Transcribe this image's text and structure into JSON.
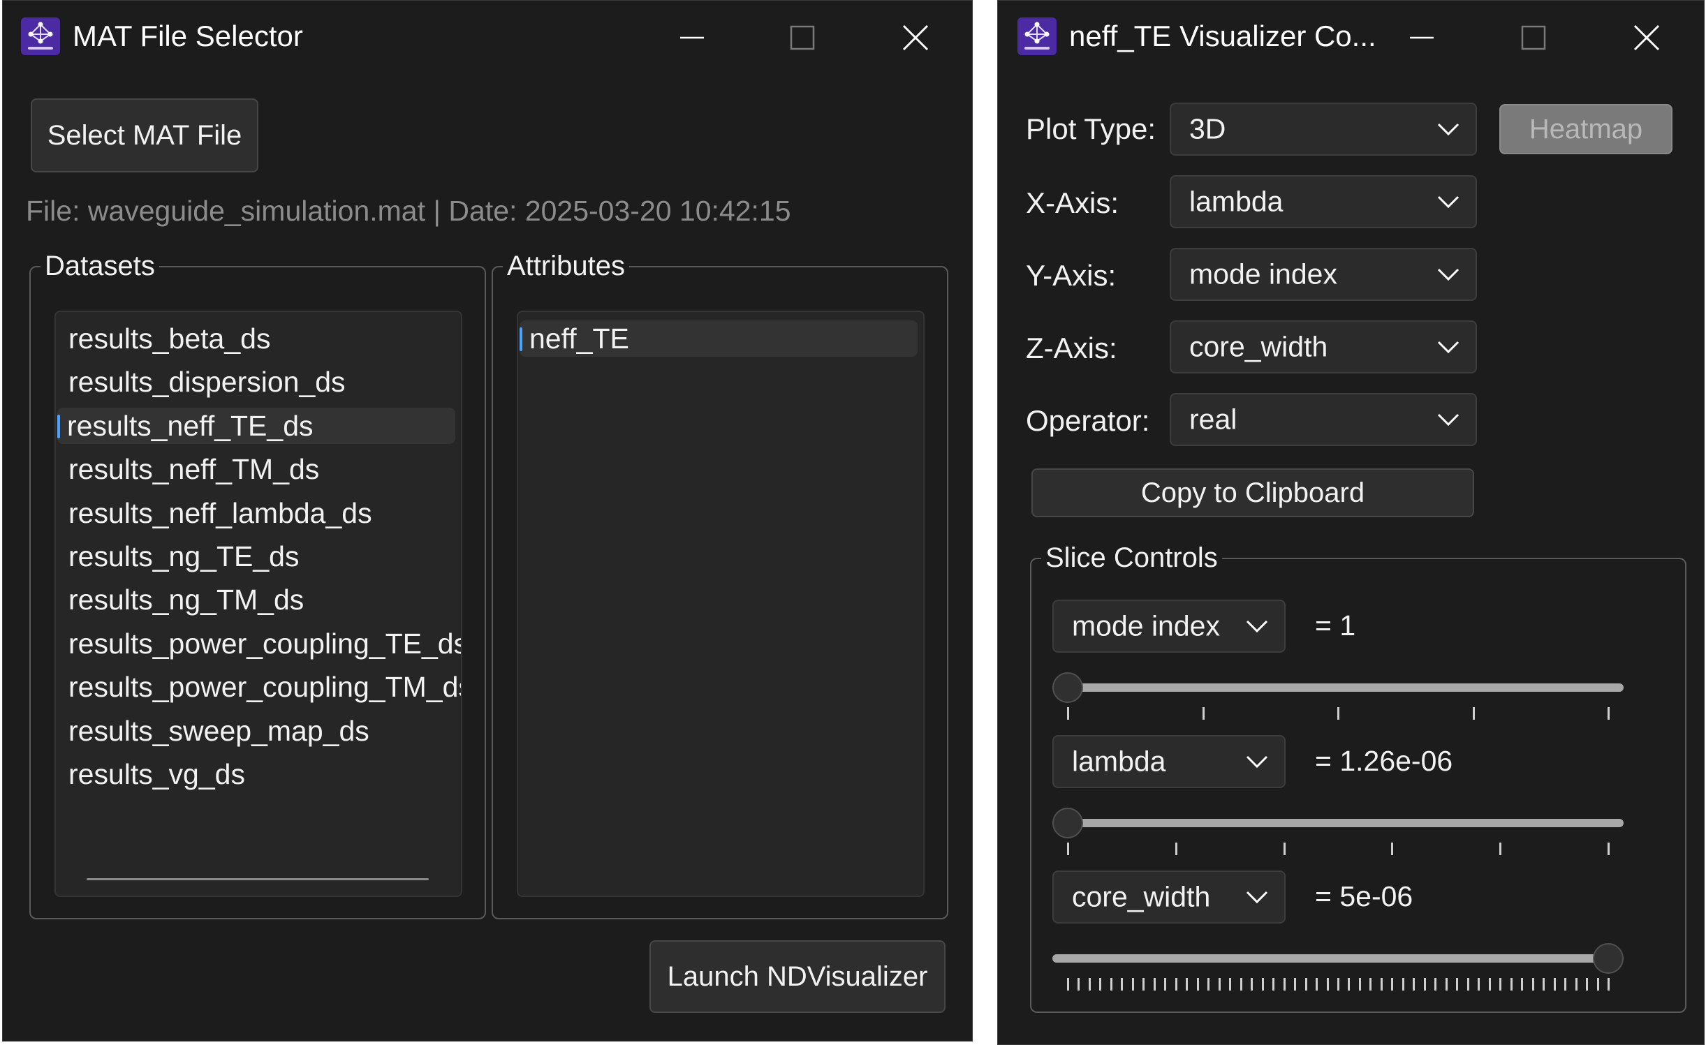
{
  "left_window": {
    "title": "MAT File Selector",
    "select_button_label": "Select MAT File",
    "file_info": "File: waveguide_simulation.mat | Date: 2025-03-20 10:42:15",
    "datasets_title": "Datasets",
    "datasets": [
      "results_beta_ds",
      "results_dispersion_ds",
      "results_neff_TE_ds",
      "results_neff_TM_ds",
      "results_neff_lambda_ds",
      "results_ng_TE_ds",
      "results_ng_TM_ds",
      "results_power_coupling_TE_ds",
      "results_power_coupling_TM_ds",
      "results_sweep_map_ds",
      "results_vg_ds"
    ],
    "selected_dataset": "results_neff_TE_ds",
    "attributes_title": "Attributes",
    "attributes": [
      "neff_TE"
    ],
    "launch_button_label": "Launch NDVisualizer"
  },
  "right_window": {
    "title": "neff_TE Visualizer Co...",
    "controls": {
      "plot_type_label": "Plot Type:",
      "plot_type_value": "3D",
      "heatmap_button_label": "Heatmap",
      "x_axis_label": "X-Axis:",
      "x_axis_value": "lambda",
      "y_axis_label": "Y-Axis:",
      "y_axis_value": "mode index",
      "z_axis_label": "Z-Axis:",
      "z_axis_value": "core_width",
      "operator_label": "Operator:",
      "operator_value": "real",
      "copy_button_label": "Copy to Clipboard"
    },
    "slice_controls": {
      "title": "Slice Controls",
      "sliders": [
        {
          "dimension": "mode index",
          "value_text": "= 1",
          "position": 0.0,
          "tick_count": 5
        },
        {
          "dimension": "lambda",
          "value_text": "= 1.26e-06",
          "position": 0.0,
          "tick_count": 6
        },
        {
          "dimension": "core_width",
          "value_text": "= 5e-06",
          "position": 1.0,
          "tick_count": 51
        }
      ]
    }
  },
  "colors": {
    "window_bg": "#1c1c1c",
    "accent": "#4aa3ff",
    "icon_bg": "#4b2aa3"
  }
}
